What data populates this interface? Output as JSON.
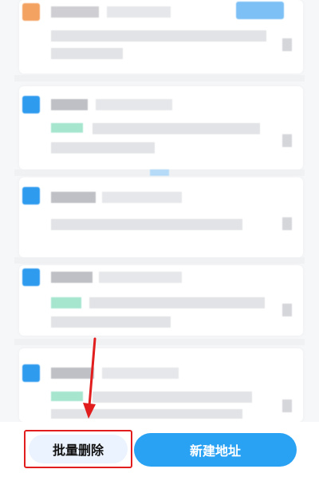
{
  "bottom_bar": {
    "batch_delete_label": "批量删除",
    "new_address_label": "新建地址"
  },
  "colors": {
    "accent_blue": "#2aa2f3",
    "highlight_red": "#e11d1d",
    "secondary_button_bg": "#eaf3ff"
  },
  "address_list": {
    "items": [
      {
        "avatar_color": "#f4a261",
        "has_tag": false
      },
      {
        "avatar_color": "#2e9bef",
        "has_tag": true
      },
      {
        "avatar_color": "#2e9bef",
        "has_tag": false
      },
      {
        "avatar_color": "#2e9bef",
        "has_tag": true
      },
      {
        "avatar_color": "#2e9bef",
        "has_tag": true
      }
    ]
  },
  "icons": [
    "edit-icon",
    "annotation-arrow-icon"
  ]
}
